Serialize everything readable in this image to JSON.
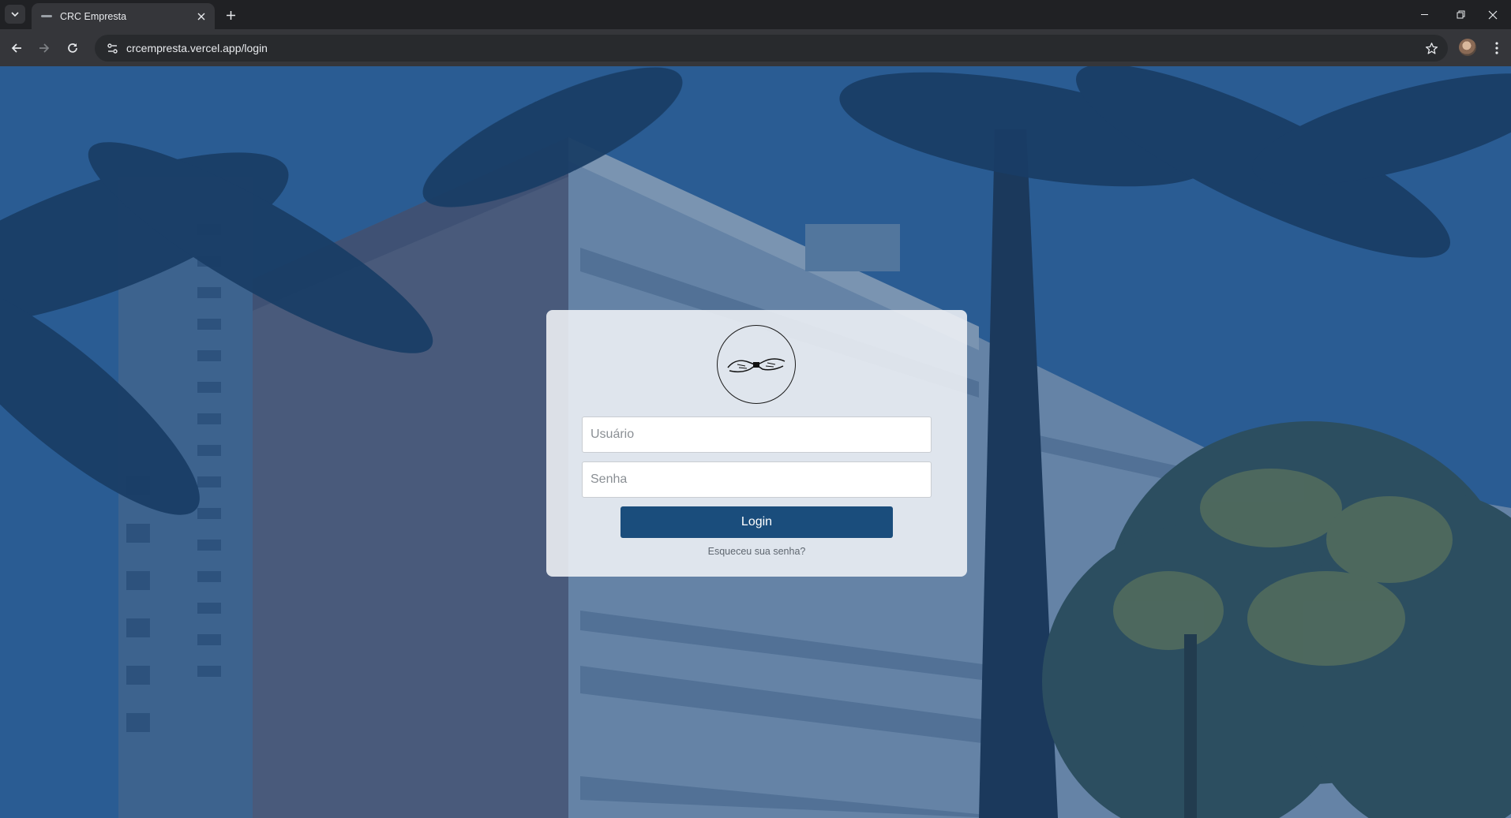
{
  "browser": {
    "tab_title": "CRC Empresta",
    "url": "crcempresta.vercel.app/login"
  },
  "login": {
    "username_placeholder": "Usuário",
    "password_placeholder": "Senha",
    "login_label": "Login",
    "forgot_label": "Esqueceu sua senha?"
  },
  "colors": {
    "primary_button": "#1a4d7c",
    "overlay": "#163e6e"
  },
  "icons": [
    "tab-search-icon",
    "close-icon",
    "plus-icon",
    "back-arrow-icon",
    "forward-arrow-icon",
    "reload-icon",
    "site-info-icon",
    "star-icon",
    "profile-avatar",
    "kebab-menu-icon",
    "minimize-icon",
    "restore-icon",
    "handshake-logo"
  ]
}
